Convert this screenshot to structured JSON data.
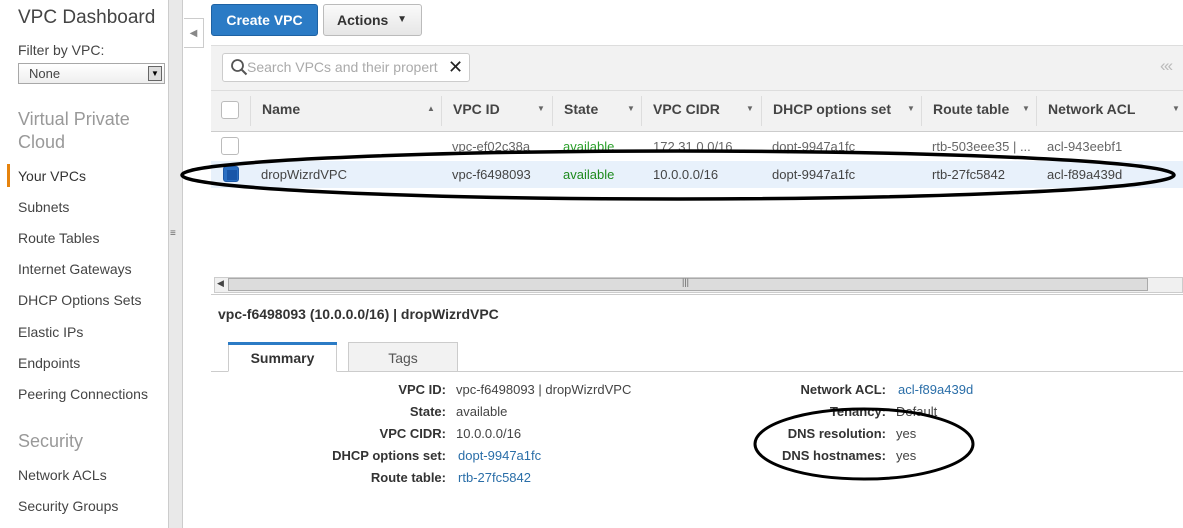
{
  "sidebar": {
    "title": "VPC Dashboard",
    "filter_label": "Filter by VPC:",
    "filter_value": "None",
    "section_vpc": "Virtual Private Cloud",
    "items": [
      "Your VPCs",
      "Subnets",
      "Route Tables",
      "Internet Gateways",
      "DHCP Options Sets",
      "Elastic IPs",
      "Endpoints",
      "Peering Connections"
    ],
    "section_security": "Security",
    "security_items": [
      "Network ACLs",
      "Security Groups"
    ],
    "active_accent": "#e6830d"
  },
  "toolbar": {
    "create_label": "Create VPC",
    "actions_label": "Actions"
  },
  "search": {
    "placeholder": "Search VPCs and their propert"
  },
  "table": {
    "columns": [
      "Name",
      "VPC ID",
      "State",
      "VPC CIDR",
      "DHCP options set",
      "Route table",
      "Network ACL"
    ],
    "rows": [
      {
        "name": "",
        "vpc_id": "vpc-ef02c38a",
        "state": "available",
        "cidr": "172.31.0.0/16",
        "dhcp": "dopt-9947a1fc",
        "route": "rtb-503eee35 | ...",
        "acl": "acl-943eebf1",
        "selected": false
      },
      {
        "name": "dropWizrdVPC",
        "vpc_id": "vpc-f6498093",
        "state": "available",
        "cidr": "10.0.0.0/16",
        "dhcp": "dopt-9947a1fc",
        "route": "rtb-27fc5842",
        "acl": "acl-f89a439d",
        "selected": true
      }
    ]
  },
  "detail": {
    "title": "vpc-f6498093 (10.0.0.0/16) | dropWizrdVPC",
    "tabs": [
      "Summary",
      "Tags"
    ],
    "left": [
      {
        "label": "VPC ID:",
        "value": "vpc-f6498093 | dropWizrdVPC"
      },
      {
        "label": "State:",
        "value": "available"
      },
      {
        "label": "VPC CIDR:",
        "value": "10.0.0.0/16"
      },
      {
        "label": "DHCP options set:",
        "value": "dopt-9947a1fc"
      },
      {
        "label": "Route table:",
        "value": "rtb-27fc5842"
      }
    ],
    "right": [
      {
        "label": "Network ACL:",
        "value": "acl-f89a439d"
      },
      {
        "label": "Tenancy:",
        "value": "Default"
      },
      {
        "label": "DNS resolution:",
        "value": "yes"
      },
      {
        "label": "DNS hostnames:",
        "value": "yes"
      }
    ]
  },
  "colors": {
    "primary_button": "#2b7bc5",
    "available": "#1d8a1d",
    "link": "#2a6ea8"
  }
}
